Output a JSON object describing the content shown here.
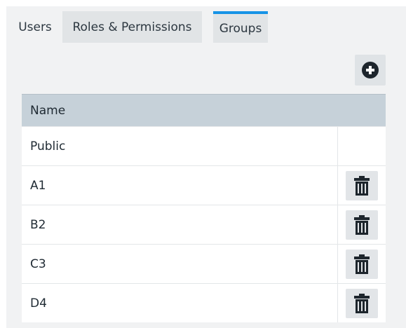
{
  "tabs": [
    {
      "label": "Users"
    },
    {
      "label": "Roles & Permissions"
    },
    {
      "label": "Groups",
      "active": true
    }
  ],
  "toolbar": {
    "add_icon": "plus-circle-icon"
  },
  "table": {
    "header": "Name",
    "rows": [
      {
        "name": "Public",
        "deletable": false
      },
      {
        "name": "A1",
        "deletable": true
      },
      {
        "name": "B2",
        "deletable": true
      },
      {
        "name": "C3",
        "deletable": true
      },
      {
        "name": "D4",
        "deletable": true
      }
    ],
    "delete_icon": "trash-icon"
  },
  "colors": {
    "active_tab_accent": "#1793e6",
    "header_bg": "#c6d1d9",
    "panel_bg": "#f1f2f3"
  }
}
